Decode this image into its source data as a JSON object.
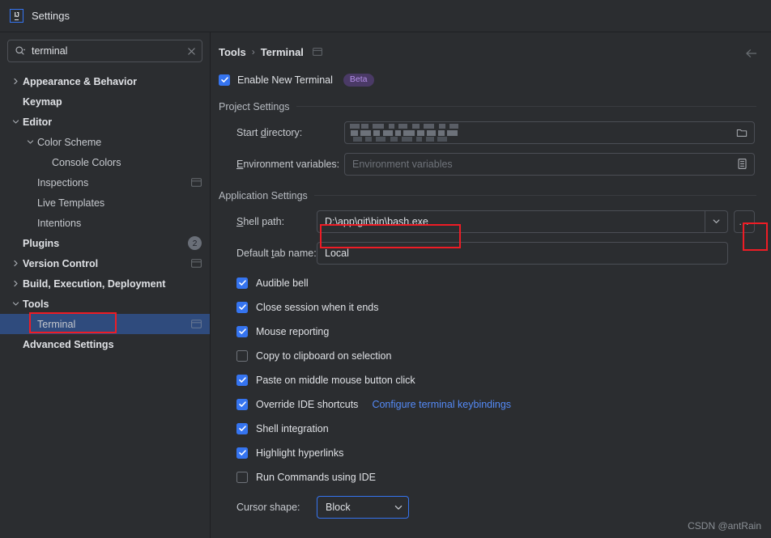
{
  "window": {
    "title": "Settings",
    "logo_text": "IJ"
  },
  "search": {
    "value": "terminal",
    "icon": "search-icon",
    "clear_icon": "close-icon"
  },
  "sidebar": {
    "items": [
      {
        "label": "Appearance & Behavior",
        "indent": 0,
        "arrow": "right",
        "bold": true,
        "scope_icon": false,
        "badge": "",
        "selected": false
      },
      {
        "label": "Keymap",
        "indent": 0,
        "arrow": "none",
        "bold": true,
        "scope_icon": false,
        "badge": "",
        "selected": false
      },
      {
        "label": "Editor",
        "indent": 0,
        "arrow": "down",
        "bold": true,
        "scope_icon": false,
        "badge": "",
        "selected": false
      },
      {
        "label": "Color Scheme",
        "indent": 1,
        "arrow": "down",
        "bold": false,
        "scope_icon": false,
        "badge": "",
        "selected": false
      },
      {
        "label": "Console Colors",
        "indent": 2,
        "arrow": "none",
        "bold": false,
        "scope_icon": false,
        "badge": "",
        "selected": false
      },
      {
        "label": "Inspections",
        "indent": 1,
        "arrow": "none",
        "bold": false,
        "scope_icon": true,
        "badge": "",
        "selected": false
      },
      {
        "label": "Live Templates",
        "indent": 1,
        "arrow": "none",
        "bold": false,
        "scope_icon": false,
        "badge": "",
        "selected": false
      },
      {
        "label": "Intentions",
        "indent": 1,
        "arrow": "none",
        "bold": false,
        "scope_icon": false,
        "badge": "",
        "selected": false
      },
      {
        "label": "Plugins",
        "indent": 0,
        "arrow": "none",
        "bold": true,
        "scope_icon": false,
        "badge": "2",
        "selected": false
      },
      {
        "label": "Version Control",
        "indent": 0,
        "arrow": "right",
        "bold": true,
        "scope_icon": true,
        "badge": "",
        "selected": false
      },
      {
        "label": "Build, Execution, Deployment",
        "indent": 0,
        "arrow": "right",
        "bold": true,
        "scope_icon": false,
        "badge": "",
        "selected": false
      },
      {
        "label": "Tools",
        "indent": 0,
        "arrow": "down",
        "bold": true,
        "scope_icon": false,
        "badge": "",
        "selected": false
      },
      {
        "label": "Terminal",
        "indent": 1,
        "arrow": "none",
        "bold": false,
        "scope_icon": true,
        "badge": "",
        "selected": true
      },
      {
        "label": "Advanced Settings",
        "indent": 0,
        "arrow": "none",
        "bold": true,
        "scope_icon": false,
        "badge": "",
        "selected": false
      }
    ]
  },
  "main": {
    "breadcrumb": {
      "parent": "Tools",
      "separator": "›",
      "current": "Terminal"
    },
    "back_icon": "back-arrow-icon",
    "enable_new_terminal": {
      "label": "Enable New Terminal",
      "checked": true,
      "badge": "Beta"
    },
    "project_settings": {
      "title": "Project Settings",
      "start_directory": {
        "label": "Start directory:",
        "label_prefix": "Start ",
        "label_accel": "d",
        "label_suffix": "irectory:",
        "value": "",
        "censored": true,
        "button_icon": "folder-icon"
      },
      "environment_variables": {
        "label": "Environment variables:",
        "label_accel": "E",
        "label_suffix": "nvironment variables:",
        "value": "",
        "placeholder": "Environment variables",
        "button_icon": "list-editor-icon"
      }
    },
    "application_settings": {
      "title": "Application Settings",
      "shell_path": {
        "label": "Shell path:",
        "label_accel": "S",
        "label_suffix": "hell path:",
        "value": "D:\\app\\git\\bin\\bash.exe",
        "dropdown_icon": "chevron-down-icon",
        "browse_label": "..."
      },
      "default_tab_name": {
        "label": "Default tab name:",
        "label_prefix": "Default ",
        "label_accel": "t",
        "label_suffix": "ab name:",
        "value": "Local"
      },
      "checkboxes": [
        {
          "label": "Audible bell",
          "checked": true,
          "link": ""
        },
        {
          "label": "Close session when it ends",
          "checked": true,
          "link": ""
        },
        {
          "label": "Mouse reporting",
          "checked": true,
          "link": ""
        },
        {
          "label": "Copy to clipboard on selection",
          "checked": false,
          "link": ""
        },
        {
          "label": "Paste on middle mouse button click",
          "checked": true,
          "link": ""
        },
        {
          "label": "Override IDE shortcuts",
          "checked": true,
          "link": "Configure terminal keybindings"
        },
        {
          "label": "Shell integration",
          "checked": true,
          "link": ""
        },
        {
          "label": "Highlight hyperlinks",
          "checked": true,
          "link": ""
        },
        {
          "label": "Run Commands using IDE",
          "checked": false,
          "link": ""
        }
      ],
      "cursor_shape": {
        "label": "Cursor shape:",
        "value": "Block",
        "chevron_icon": "chevron-down-icon"
      }
    }
  },
  "watermark": "CSDN @antRain",
  "colors": {
    "accent": "#3574f0",
    "link": "#548af7",
    "selection": "#2f4b7d",
    "annotation": "#ee1c25",
    "beta_bg": "#4a3a66",
    "beta_fg": "#b48ee8"
  }
}
